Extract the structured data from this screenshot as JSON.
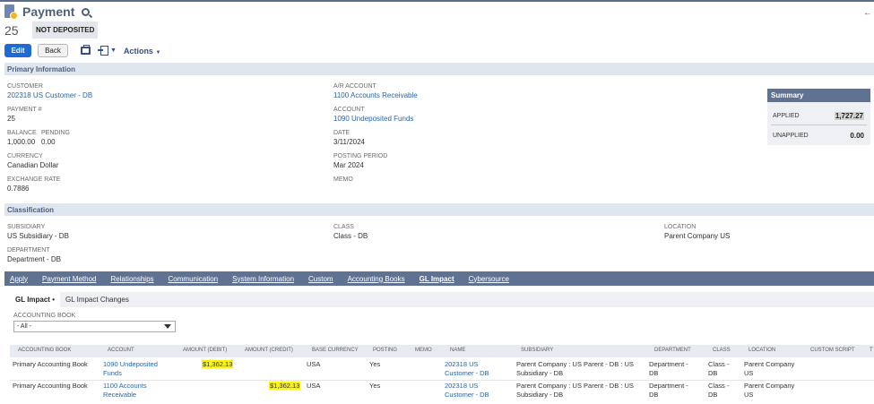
{
  "header": {
    "title": "Payment",
    "record_number": "25",
    "status": "NOT DEPOSITED"
  },
  "buttons": {
    "edit": "Edit",
    "back": "Back",
    "actions": "Actions"
  },
  "sections": {
    "primary": "Primary Information",
    "classification": "Classification"
  },
  "primary": {
    "customer_label": "CUSTOMER",
    "customer_value": "202318 US Customer - DB",
    "payment_label": "PAYMENT #",
    "payment_value": "25",
    "balance_label": "BALANCE",
    "balance_value": "1,000.00",
    "pending_label": "PENDING",
    "pending_value": "0.00",
    "currency_label": "CURRENCY",
    "currency_value": "Canadian Dollar",
    "exchange_label": "EXCHANGE RATE",
    "exchange_value": "0.7886",
    "ar_label": "A/R ACCOUNT",
    "ar_value": "1100 Accounts Receivable",
    "account_label": "ACCOUNT",
    "account_value": "1090 Undeposited Funds",
    "date_label": "DATE",
    "date_value": "3/11/2024",
    "period_label": "POSTING PERIOD",
    "period_value": "Mar 2024",
    "memo_label": "MEMO"
  },
  "summary": {
    "title": "Summary",
    "applied_label": "APPLIED",
    "applied_value": "1,727.27",
    "unapplied_label": "UNAPPLIED",
    "unapplied_value": "0.00"
  },
  "classification": {
    "subsidiary_label": "SUBSIDIARY",
    "subsidiary_value": "US Subsidiary - DB",
    "department_label": "DEPARTMENT",
    "department_value": "Department - DB",
    "class_label": "CLASS",
    "class_value": "Class - DB",
    "location_label": "LOCATION",
    "location_value": "Parent Company US"
  },
  "tabs": [
    "Apply",
    "Payment Method",
    "Relationships",
    "Communication",
    "System Information",
    "Custom",
    "Accounting Books",
    "GL Impact",
    "Cybersource"
  ],
  "active_tab": "GL Impact",
  "subtabs": [
    "GL Impact •",
    "GL Impact Changes"
  ],
  "gl": {
    "book_label": "ACCOUNTING BOOK",
    "book_value": "- All -",
    "columns": [
      "ACCOUNTING BOOK",
      "ACCOUNT",
      "AMOUNT (DEBIT)",
      "AMOUNT (CREDIT)",
      "BASE CURRENCY",
      "POSTING",
      "MEMO",
      "NAME",
      "SUBSIDIARY",
      "DEPARTMENT",
      "CLASS",
      "LOCATION",
      "CUSTOM SCRIPT",
      "T"
    ],
    "rows": [
      {
        "book": "Primary Accounting Book",
        "account_l1": "1090 Undeposited",
        "account_l2": "Funds",
        "debit": "$1,362.13",
        "credit": "",
        "currency": "USA",
        "posting": "Yes",
        "name_l1": "202318 US",
        "name_l2": "Customer - DB",
        "subsidiary_l1": "Parent Company : US Parent - DB : US",
        "subsidiary_l2": "Subsidiary - DB",
        "department_l1": "Department -",
        "department_l2": "DB",
        "class_l1": "Class -",
        "class_l2": "DB",
        "location_l1": "Parent Company",
        "location_l2": "US"
      },
      {
        "book": "Primary Accounting Book",
        "account_l1": "1100 Accounts",
        "account_l2": "Receivable",
        "debit": "",
        "credit": "$1,362.13",
        "currency": "USA",
        "posting": "Yes",
        "name_l1": "202318 US",
        "name_l2": "Customer - DB",
        "subsidiary_l1": "Parent Company : US Parent - DB : US",
        "subsidiary_l2": "Subsidiary - DB",
        "department_l1": "Department -",
        "department_l2": "DB",
        "class_l1": "Class -",
        "class_l2": "DB",
        "location_l1": "Parent Company",
        "location_l2": "US"
      }
    ]
  },
  "colors": {
    "accent": "#1f6ad4",
    "header_band": "#5f7292",
    "section_band": "#e0e6ef",
    "link": "#2a64a8",
    "highlight": "#fbf50c"
  }
}
